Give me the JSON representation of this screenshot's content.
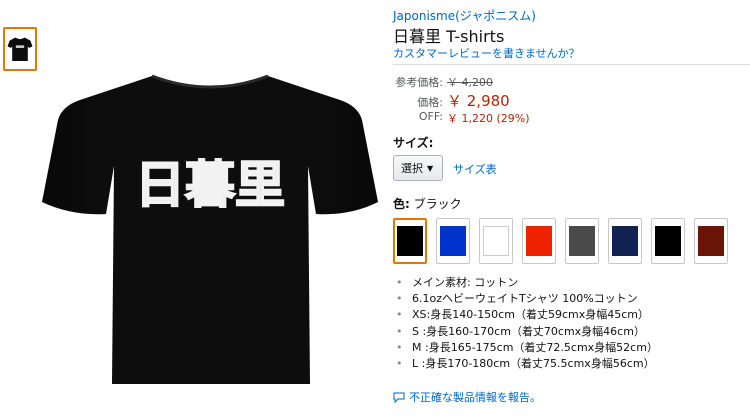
{
  "product": {
    "brand": "Japonisme(ジャポニスム)",
    "title": "日暮里 T-shirts",
    "review_link": "カスタマーレビューを書きませんか？",
    "shirt_print": "日暮里",
    "shirt_color": "#0d0d0d"
  },
  "pricing": {
    "list_label": "参考価格:",
    "list_price": "￥ 4,200",
    "price_label": "価格:",
    "price": "￥ 2,980",
    "off_label": "OFF:",
    "off_value": "￥ 1,220 (29%)"
  },
  "size": {
    "label": "サイズ:",
    "selected": "選択",
    "chart_link": "サイズ表"
  },
  "color": {
    "label": "色:",
    "value": "ブラック",
    "swatches": [
      "#000000",
      "#0033cc",
      "#ffffff",
      "#ee2200",
      "#4a4a4a",
      "#0f2252",
      "#000000",
      "#6b1408"
    ]
  },
  "features": [
    "メイン素材: コットン",
    "6.1ozヘビーウェイトTシャツ 100%コットン",
    "XS:身長140-150cm（着丈59cmx身幅45cm）",
    "S :身長160-170cm（着丈70cmx身幅46cm）",
    "M :身長165-175cm（着丈72.5cmx身幅52cm）",
    "L :身長170-180cm（着丈75.5cmx身幅56cm）"
  ],
  "report_link": "不正確な製品情報を報告。",
  "colors": {
    "link": "#0066c0",
    "price": "#b12704",
    "selected_border": "#e77600"
  }
}
